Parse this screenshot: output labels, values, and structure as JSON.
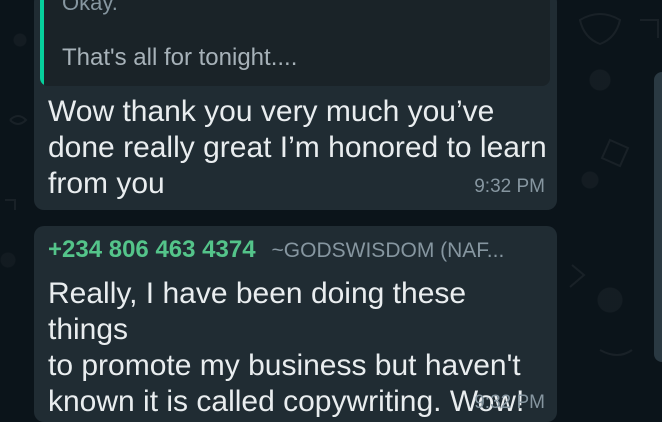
{
  "messages": [
    {
      "quote": {
        "top_text": "Okay.",
        "text": "That's all for tonight...."
      },
      "text": "Wow thank you very much you’ve\ndone really great I’m honored to learn\nfrom you",
      "time": "9:32 PM"
    },
    {
      "sender_number": "+234 806 463 4374",
      "sender_name": "~GODSWISDOM (NAF...",
      "text": "Really, I have been doing these things\nto promote my business but haven't\nknown it is called copywriting. Wow!",
      "time": "9:32 PM"
    }
  ]
}
